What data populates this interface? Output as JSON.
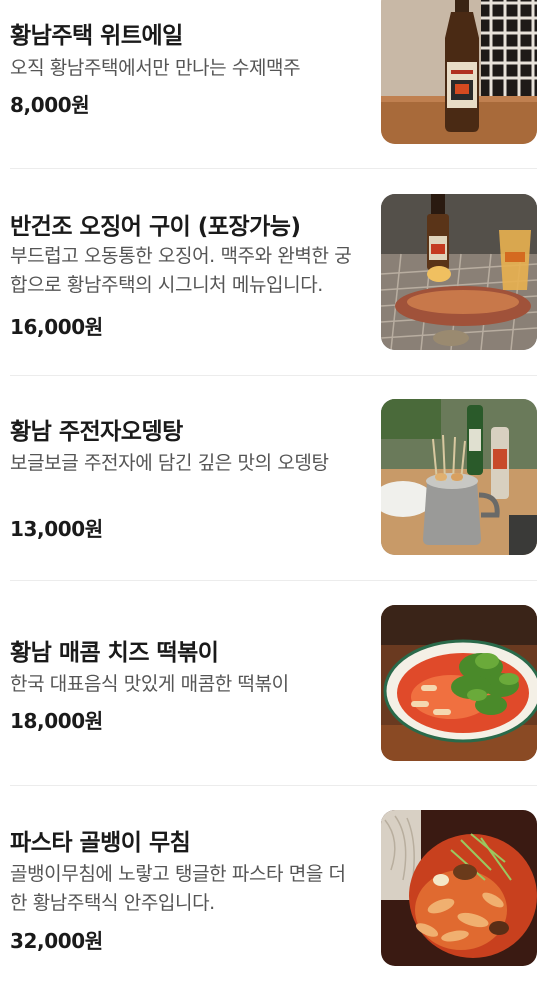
{
  "menu": {
    "items": [
      {
        "name": "황남주택 위트에일",
        "description": "오직 황남주택에서만 만나는 수제맥주",
        "price": "8,000원",
        "image_icon": "wheat-ale-bottle-photo"
      },
      {
        "name": "반건조 오징어 구이 (포장가능)",
        "description": "부드럽고 오동통한 오징어. 맥주와 완벽한 궁합으로 황남주택의 시그니처 메뉴입니다.",
        "price": "16,000원",
        "image_icon": "grilled-squid-photo"
      },
      {
        "name": "황남 주전자오뎅탕",
        "description": "보글보글 주전자에 담긴 깊은 맛의 오뎅탕",
        "price": "13,000원",
        "image_icon": "fishcake-soup-kettle-photo"
      },
      {
        "name": "황남 매콤 치즈 떡볶이",
        "description": "한국 대표음식 맛있게 매콤한 떡볶이",
        "price": "18,000원",
        "image_icon": "cheese-tteokbokki-photo"
      },
      {
        "name": "파스타 골뱅이 무침",
        "description": "골뱅이무침에 노랗고 탱글한 파스타 면을 더한 황남주택식 안주입니다.",
        "price": "32,000원",
        "image_icon": "pasta-whelk-salad-photo"
      }
    ]
  }
}
